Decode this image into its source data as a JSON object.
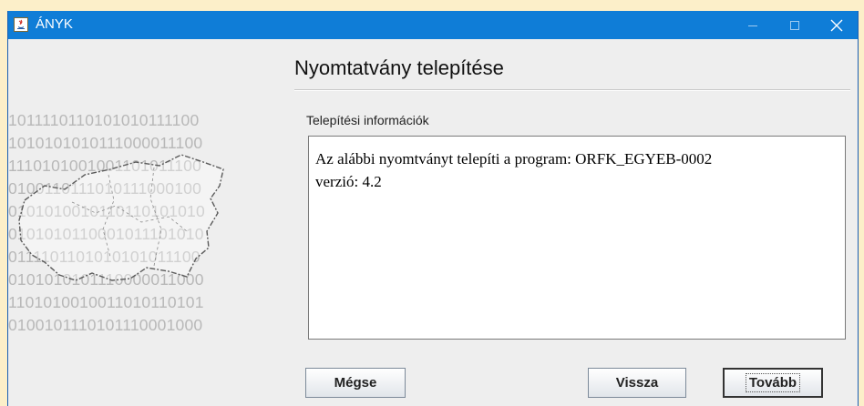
{
  "window": {
    "title": "ÁNYK",
    "controls": {
      "minimize": "minimize-icon",
      "maximize": "maximize-icon",
      "close": "close-icon"
    },
    "titlebar_color": "#0F7DD7"
  },
  "page": {
    "heading": "Nyomtatvány telepítése"
  },
  "decoration": {
    "binary_lines": [
      "1011110110101010111100",
      "1010101010111000011100",
      "1110101001001101011100",
      "0100110111010111000100",
      "0101010010110110101010",
      "0101010110001011101010",
      "0111101101010101011100",
      "0101010101110000011000",
      "1101010010011010110101",
      "0100101110101110001000"
    ],
    "map_icon": "hungary-map-outline"
  },
  "info": {
    "label": "Telepítési információk",
    "lines": [
      "Az alábbi nyomtványt telepíti a program: ORFK_EGYEB-0002",
      "verzió: 4.2"
    ]
  },
  "buttons": {
    "cancel": "Mégse",
    "back": "Vissza",
    "next": "Tovább"
  }
}
